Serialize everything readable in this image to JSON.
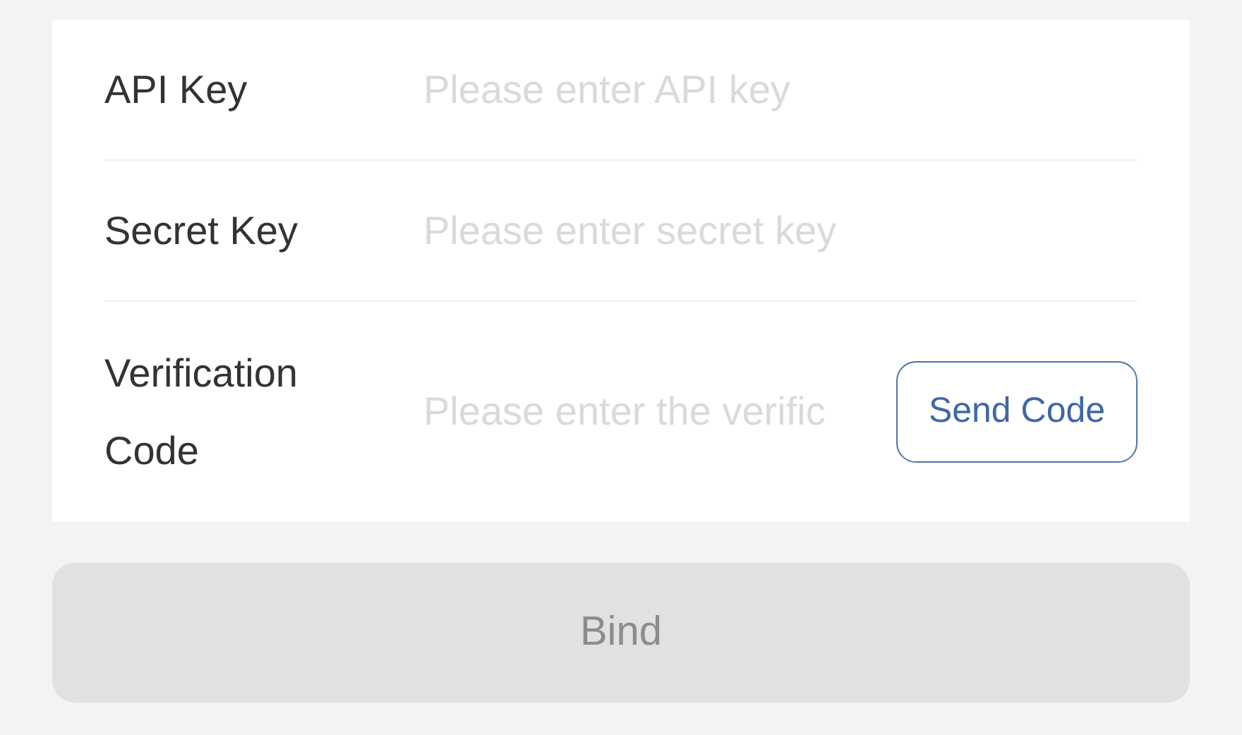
{
  "form": {
    "fields": [
      {
        "label": "API Key",
        "placeholder": "Please enter API key"
      },
      {
        "label": "Secret Key",
        "placeholder": "Please enter secret key"
      },
      {
        "label": "Verification Code",
        "placeholder": "Please enter the verific",
        "action": "Send Code"
      }
    ]
  },
  "submit": {
    "label": "Bind",
    "disabled": true
  }
}
